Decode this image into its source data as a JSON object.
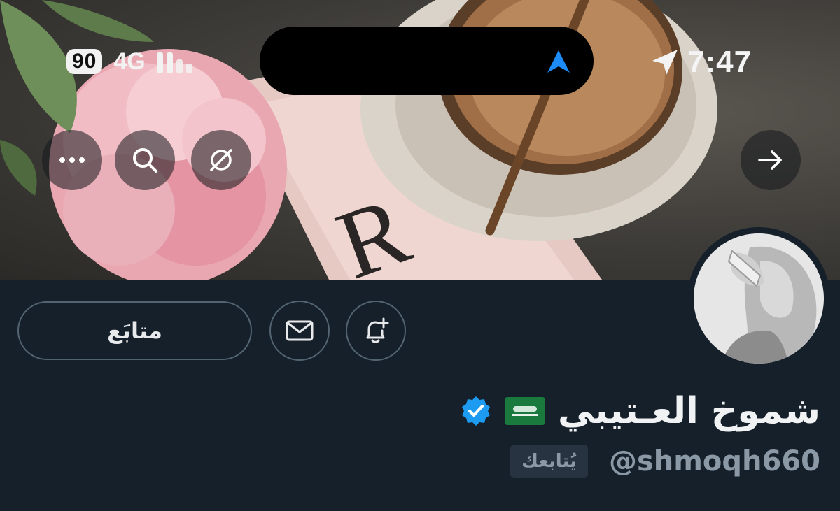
{
  "status_bar": {
    "battery": "90",
    "network": "4G",
    "time": "7:47",
    "icons": [
      "signal-bars-icon",
      "navigation-arrow-icon",
      "location-arrow-icon"
    ]
  },
  "nav": {
    "buttons": [
      "more-icon",
      "search-icon",
      "grok-icon",
      "forward-arrow-icon"
    ]
  },
  "profile": {
    "name": "شموخ العـتيبي",
    "flag_emoji": "🇸🇦",
    "verified": true,
    "handle": "@shmoqh660",
    "follows_you_label": "يُتابعك",
    "follow_button_label": "متابَع",
    "actions": [
      "message-icon",
      "notification-bell-icon"
    ]
  },
  "colors": {
    "background": "#15202b",
    "border": "#536471",
    "secondary_text": "#8b98a5",
    "verified_blue": "#1d9bf0",
    "accent_arrow": "#1d8cf8"
  }
}
